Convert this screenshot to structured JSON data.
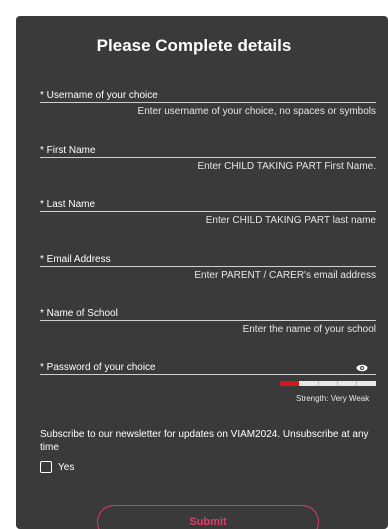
{
  "form": {
    "title": "Please Complete details",
    "fields": [
      {
        "label": "* Username of your choice",
        "hint": "Enter username of your choice, no spaces or symbols"
      },
      {
        "label": "* First Name",
        "hint": "Enter CHILD TAKING PART First Name."
      },
      {
        "label": "* Last Name",
        "hint": "Enter CHILD TAKING PART last name"
      },
      {
        "label": "* Email Address",
        "hint": "Enter PARENT / CARER's email address"
      },
      {
        "label": "* Name of School",
        "hint": "Enter the name of your school"
      },
      {
        "label": "* Password of your choice",
        "hint": ""
      }
    ],
    "password_strength": {
      "label": "Strength: Very Weak",
      "level": 0.2,
      "color": "#d11a1a"
    },
    "newsletter": {
      "text": "Subscribe to our newsletter for updates on VIAM2024. Unsubscribe at any time",
      "checkbox_label": "Yes",
      "checked": false
    },
    "submit_label": "Submit",
    "accent_color": "#e23a67"
  }
}
